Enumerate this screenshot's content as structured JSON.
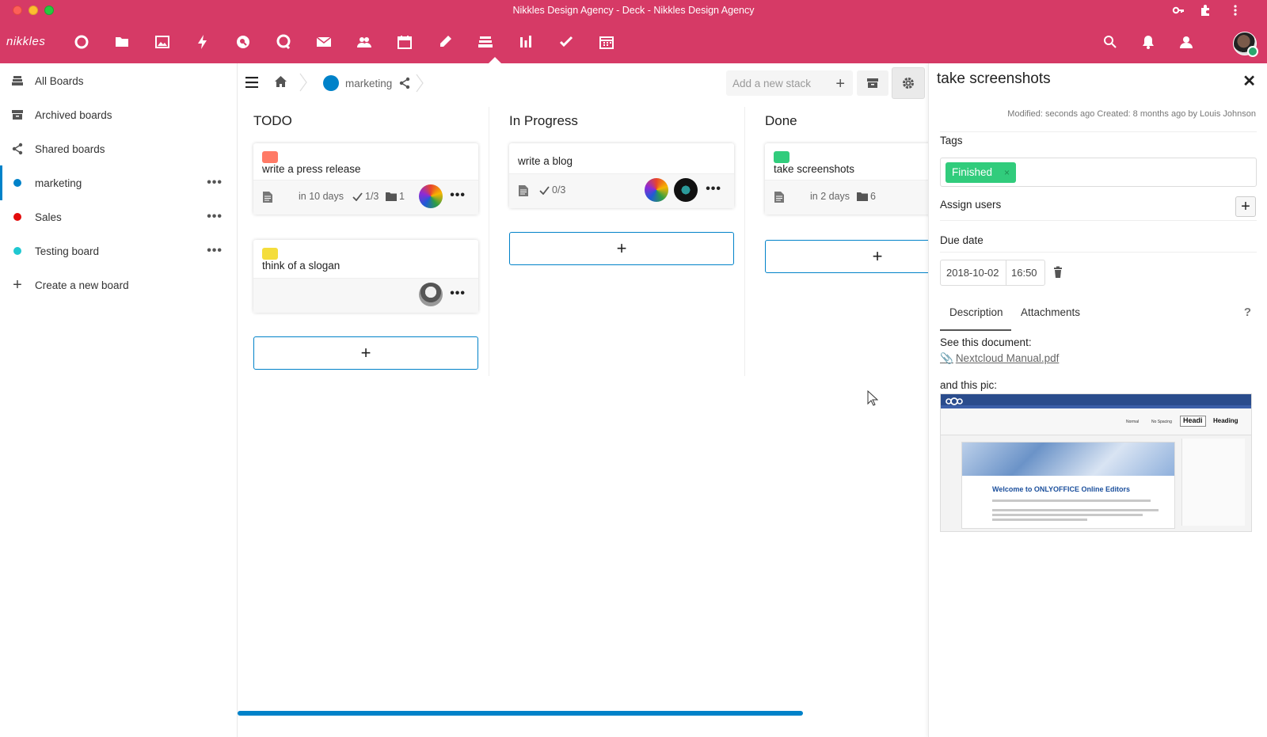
{
  "window": {
    "title": "Nikkles Design Agency - Deck - Nikkles Design Agency"
  },
  "header": {
    "logo": "nikkles",
    "apps": [
      "dashboard-icon",
      "files-icon",
      "photos-icon",
      "activity-icon",
      "search-apps-icon",
      "talk-icon",
      "mail-icon",
      "contacts-icon",
      "calendar-icon",
      "notes-icon",
      "deck-icon",
      "analytics-icon",
      "tasks-icon",
      "schedule-icon"
    ],
    "active_app": "deck-icon",
    "accent": "#d63a66"
  },
  "sidebar": {
    "items": [
      {
        "label": "All Boards",
        "icon": "boards-icon"
      },
      {
        "label": "Archived boards",
        "icon": "archive-icon"
      },
      {
        "label": "Shared boards",
        "icon": "share-icon"
      },
      {
        "label": "marketing",
        "color": "#0082c9",
        "active": true
      },
      {
        "label": "Sales",
        "color": "#e30b0b"
      },
      {
        "label": "Testing board",
        "color": "#1fc8d1"
      },
      {
        "label": "Create a new board",
        "icon": "plus-icon"
      }
    ],
    "more": "•••"
  },
  "board": {
    "name": "marketing",
    "color": "#0082c9",
    "add_stack_placeholder": "Add a new stack",
    "stacks": [
      {
        "title": "TODO",
        "cards": [
          {
            "title": "write a press release",
            "label_color": "#ff7a66",
            "due": "in 10 days",
            "checklist": "1/3",
            "attachments": "1"
          },
          {
            "title": "think of a slogan",
            "label_color": "#f4dd3c"
          }
        ]
      },
      {
        "title": "In Progress",
        "cards": [
          {
            "title": "write a blog",
            "checklist": "0/3"
          }
        ]
      },
      {
        "title": "Done",
        "cards": [
          {
            "title": "take screenshots",
            "label_color": "#31cc7c",
            "due": "in 2 days",
            "attachments": "6"
          }
        ]
      }
    ],
    "add_card": "+",
    "card_more": "•••"
  },
  "details": {
    "title": "take screenshots",
    "meta": "Modified: seconds ago Created: 8 months ago by Louis Johnson",
    "tags_label": "Tags",
    "tag": {
      "name": "Finished",
      "color": "#31cc7c",
      "remove": "×"
    },
    "assign_label": "Assign users",
    "assign_plus": "+",
    "due_label": "Due date",
    "due_date": "2018-10-02",
    "due_time": "16:50",
    "tabs": [
      "Description",
      "Attachments"
    ],
    "help": "?",
    "close": "✕",
    "desc_line1": "See this document:",
    "doc_link": "Nextcloud Manual.pdf",
    "desc_line2": "and this pic:",
    "pic": {
      "heading": "Welcome to ONLYOFFICE Online Editors",
      "style_normal": "Normal",
      "style_nospacing": "No Spacing",
      "style_h1": "Headi",
      "style_h2": "Heading"
    }
  }
}
